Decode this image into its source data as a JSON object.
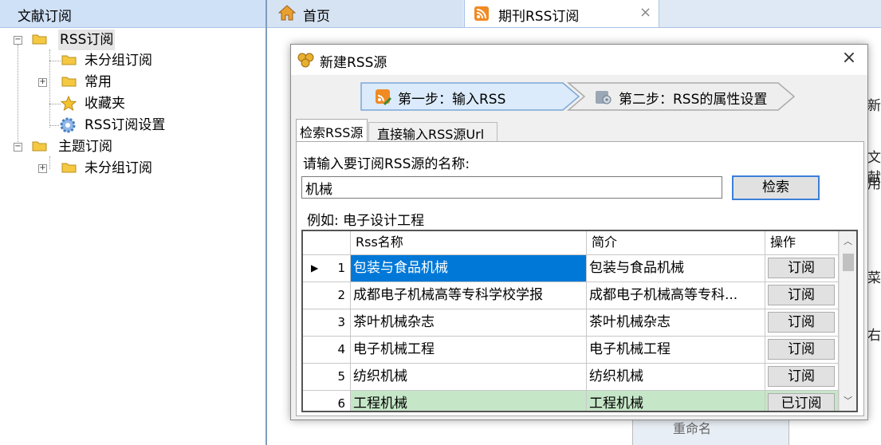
{
  "left_panel": {
    "title": "文献订阅",
    "tree": [
      {
        "label": "RSS订阅"
      },
      {
        "label": "未分组订阅"
      },
      {
        "label": "常用"
      },
      {
        "label": "收藏夹"
      },
      {
        "label": "RSS订阅设置"
      },
      {
        "label": "主题订阅"
      },
      {
        "label": "未分组订阅"
      }
    ]
  },
  "tabs": [
    {
      "label": "首页"
    },
    {
      "label": "期刊RSS订阅",
      "close": "×"
    }
  ],
  "background": {
    "side_chars": [
      "新",
      "文献",
      "用",
      "菜",
      "右"
    ],
    "menu_item": "重命名"
  },
  "dialog": {
    "title": "新建RSS源",
    "close": "×",
    "steps": [
      {
        "label": "第一步：输入RSS"
      },
      {
        "label": "第二步：RSS的属性设置"
      }
    ],
    "inner_tabs": [
      "检索RSS源",
      "直接输入RSS源Url"
    ],
    "prompt": "请输入要订阅RSS源的名称:",
    "search_value": "机械",
    "search_button": "检索",
    "example": "例如: 电子设计工程",
    "grid": {
      "columns": [
        "Rss名称",
        "简介",
        "操作"
      ],
      "rows": [
        {
          "num": "1",
          "name": "包装与食品机械",
          "desc": "包装与食品机械",
          "op": "订阅"
        },
        {
          "num": "2",
          "name": "成都电子机械高等专科学校学报",
          "desc": "成都电子机械高等专科...",
          "op": "订阅"
        },
        {
          "num": "3",
          "name": "茶叶机械杂志",
          "desc": "茶叶机械杂志",
          "op": "订阅"
        },
        {
          "num": "4",
          "name": "电子机械工程",
          "desc": "电子机械工程",
          "op": "订阅"
        },
        {
          "num": "5",
          "name": "纺织机械",
          "desc": "纺织机械",
          "op": "订阅"
        },
        {
          "num": "6",
          "name": "工程机械",
          "desc": "工程机械",
          "op": "已订阅"
        }
      ]
    }
  },
  "colors": {
    "selected_row": "#0078d7",
    "subscribed_row": "#c6e6c8",
    "folder": "#f5c842",
    "accent_border": "#3c7fd9"
  }
}
